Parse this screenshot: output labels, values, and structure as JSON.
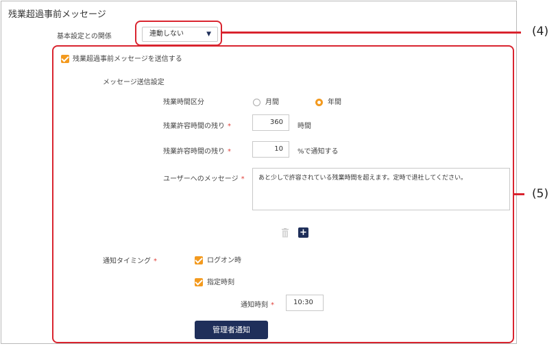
{
  "panel": {
    "title": "残業超過事前メッセージ"
  },
  "basic_setting": {
    "label": "基本設定との関係",
    "select_value": "連動しない"
  },
  "send_checkbox": {
    "label": "残業超過事前メッセージを送信する",
    "checked": true
  },
  "message_settings": {
    "section_label": "メッセージ送信設定",
    "overtime_category": {
      "label": "残業時間区分",
      "options": [
        {
          "label": "月間",
          "selected": false
        },
        {
          "label": "年間",
          "selected": true
        }
      ]
    },
    "remaining_hours": {
      "label": "残業許容時間の残り",
      "required_mark": "*",
      "value": "360",
      "unit": "時間"
    },
    "remaining_percent": {
      "label": "残業許容時間の残り",
      "required_mark": "*",
      "value": "10",
      "unit": "%で通知する"
    },
    "user_message": {
      "label": "ユーザーへのメッセージ",
      "required_mark": "*",
      "value": "あと少しで許容されている残業時間を超えます。定時で退社してください。"
    }
  },
  "notify_timing": {
    "label": "通知タイミング",
    "required_mark": "*",
    "options": [
      {
        "label": "ログオン時",
        "checked": true
      },
      {
        "label": "指定時刻",
        "checked": true
      }
    ],
    "time_label": "通知時刻",
    "time_required_mark": "*",
    "time_value": "10:30"
  },
  "admin_button": {
    "label": "管理者通知"
  },
  "callouts": {
    "c4": "(4)",
    "c5": "(5)"
  },
  "colors": {
    "accent_orange": "#f39a1f",
    "navy": "#1f2f5a",
    "callout_red": "#d9232e"
  },
  "icons": {
    "select_caret": "▼",
    "trash": "trash-icon",
    "plus": "+"
  }
}
